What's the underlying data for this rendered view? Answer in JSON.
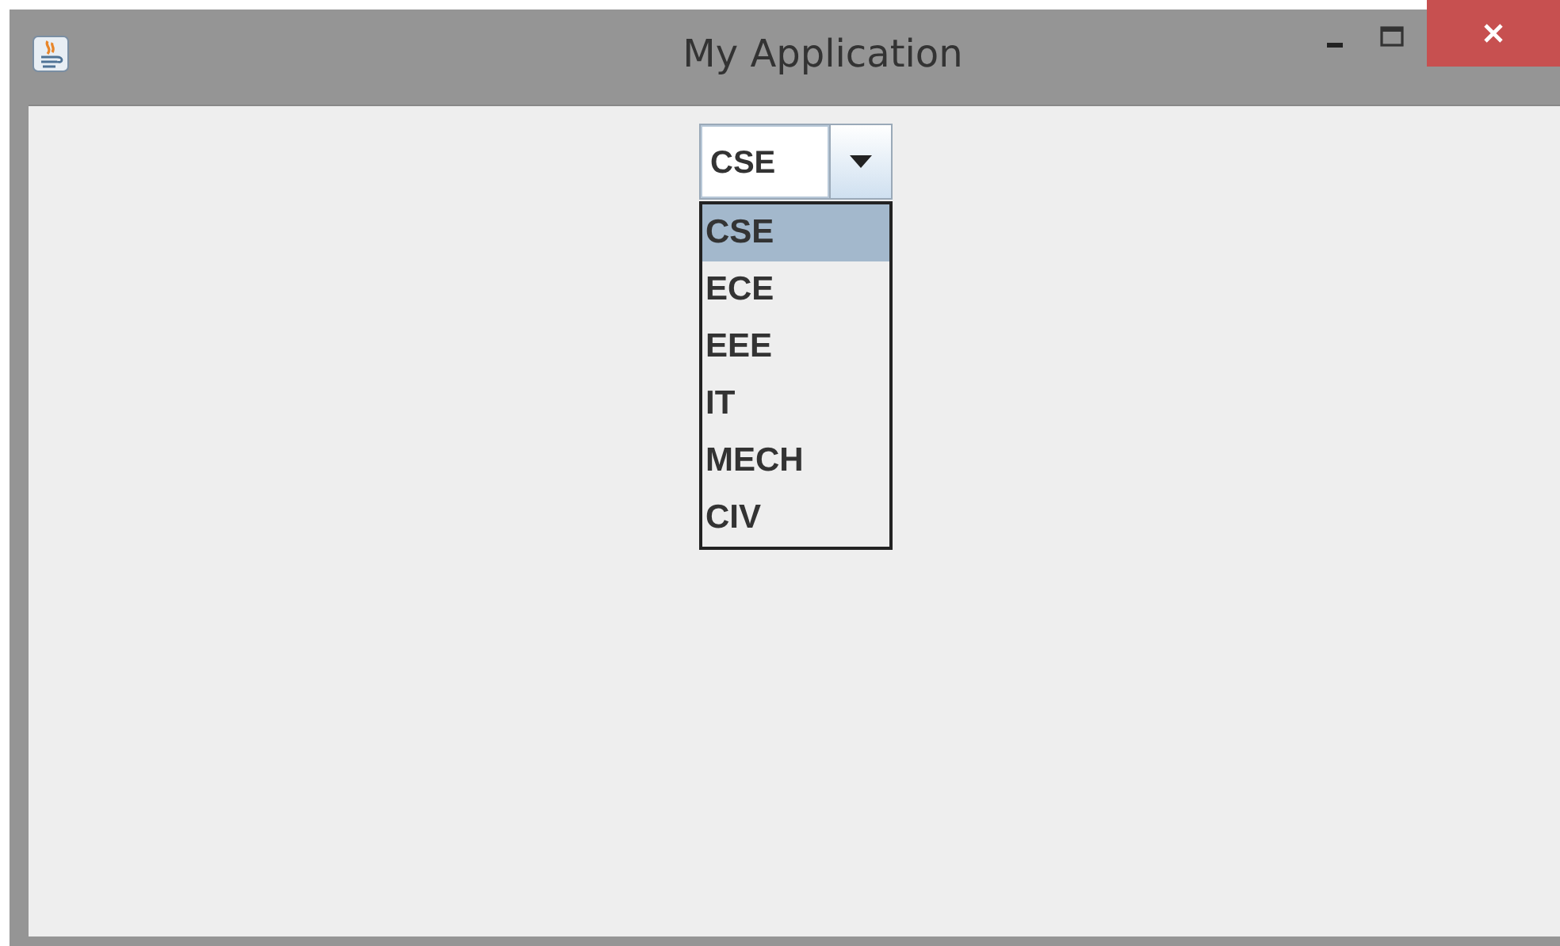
{
  "window": {
    "title": "My Application"
  },
  "combo": {
    "value": "CSE",
    "expanded": true
  },
  "options": [
    {
      "label": "CSE",
      "selected": true
    },
    {
      "label": "ECE",
      "selected": false
    },
    {
      "label": "EEE",
      "selected": false
    },
    {
      "label": "IT",
      "selected": false
    },
    {
      "label": "MECH",
      "selected": false
    },
    {
      "label": "CIV",
      "selected": false
    }
  ]
}
